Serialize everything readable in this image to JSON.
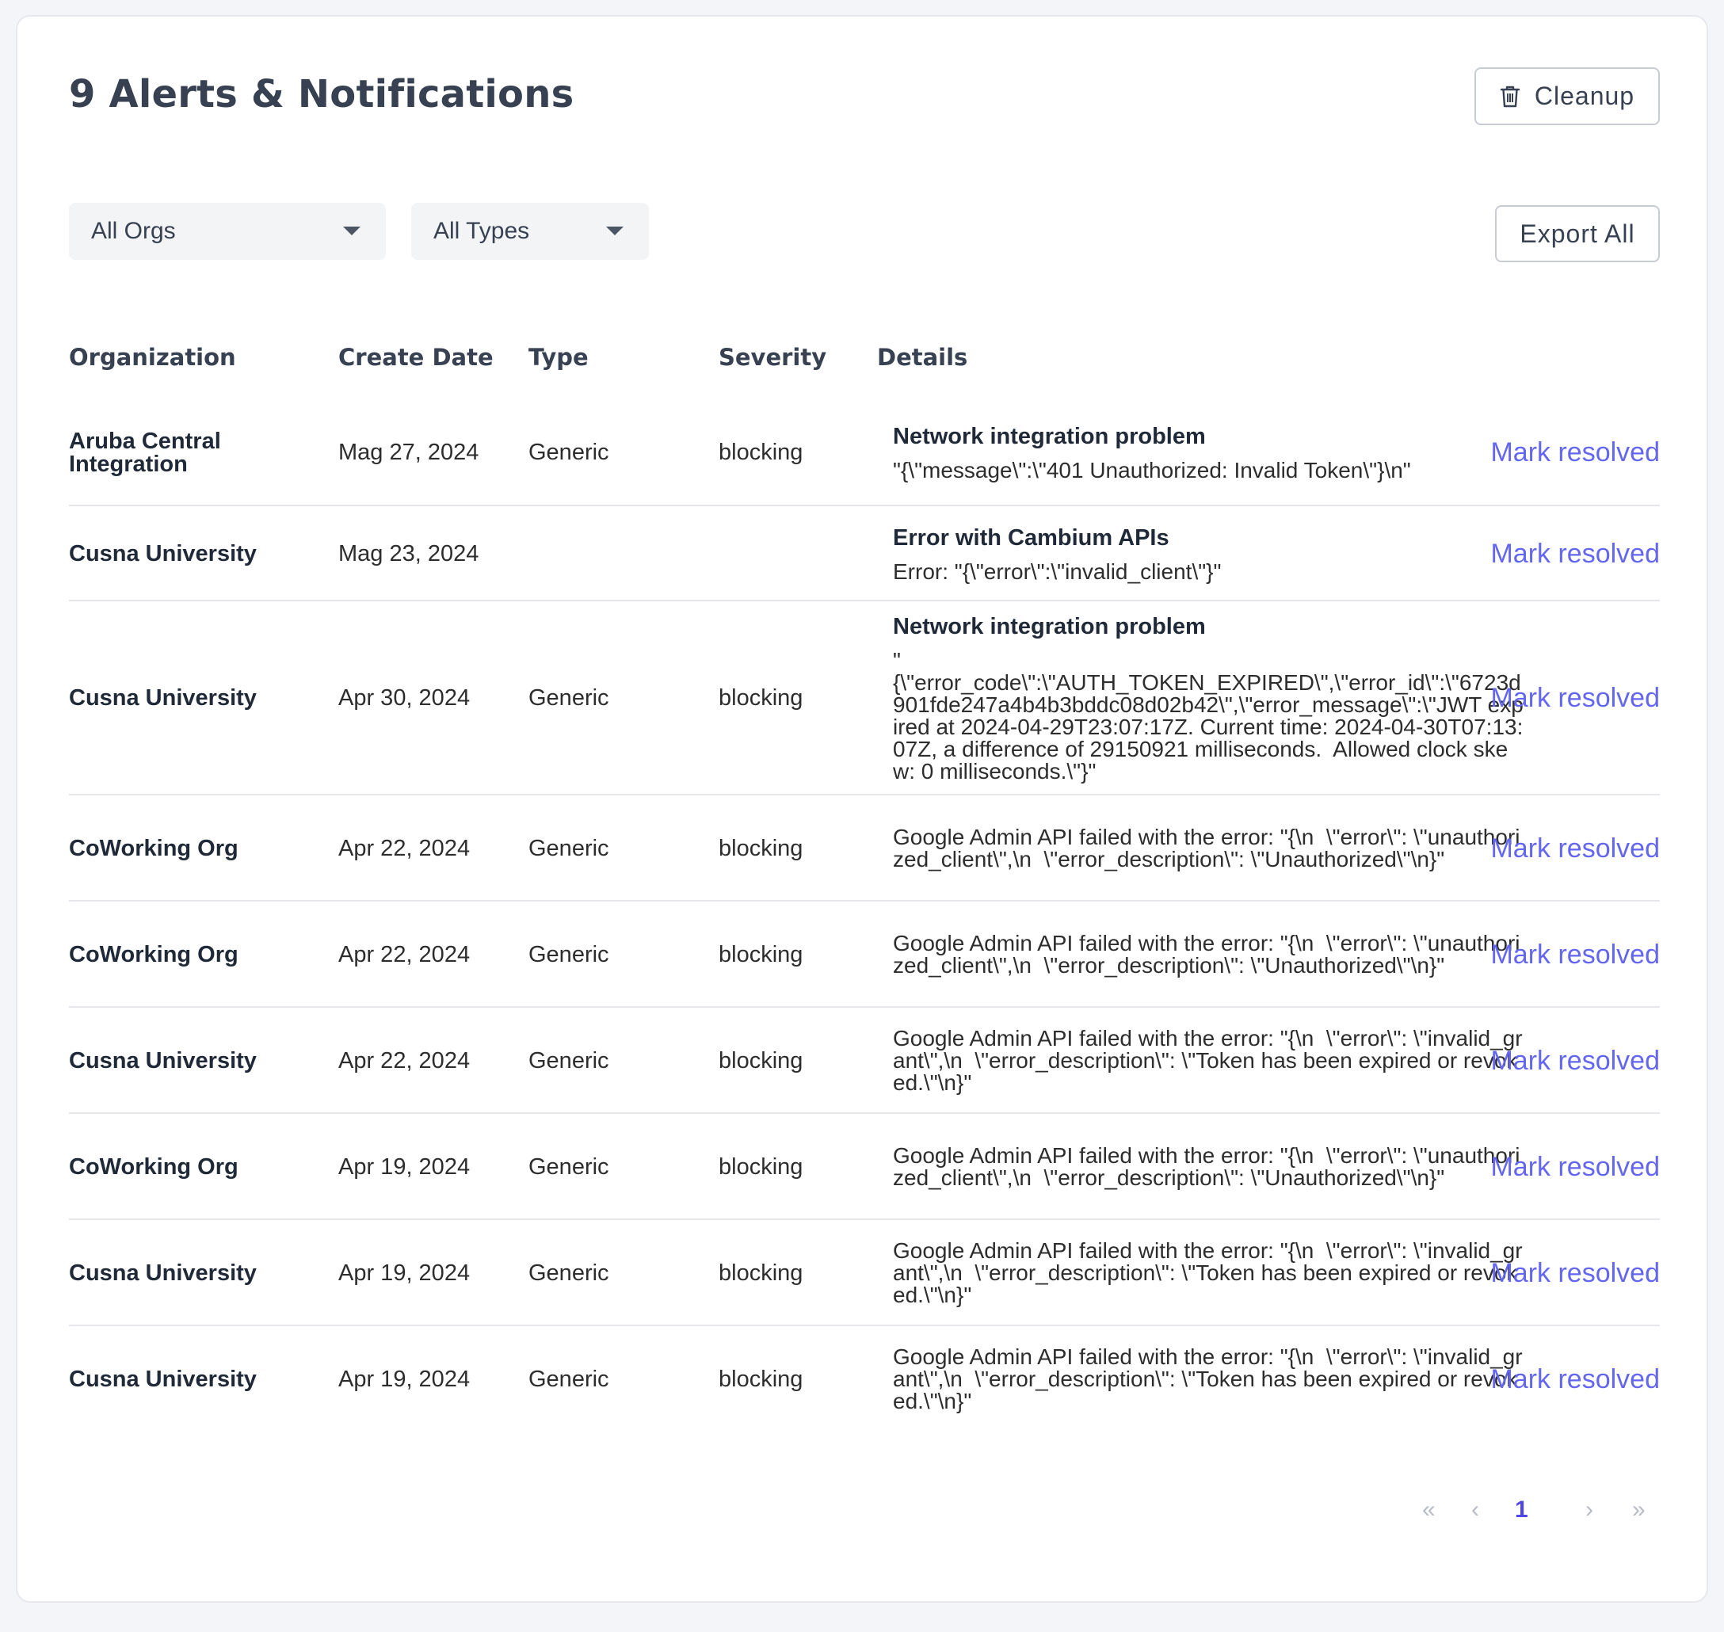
{
  "header": {
    "title": "9 Alerts & Notifications",
    "cleanup_label": "Cleanup",
    "cleanup_icon": "trash-icon",
    "export_label": "Export All"
  },
  "filters": {
    "org_selected": "All Orgs",
    "type_selected": "All Types"
  },
  "table": {
    "columns": [
      "Organization",
      "Create Date",
      "Type",
      "Severity",
      "Details"
    ],
    "action_label": "Mark resolved",
    "rows": [
      {
        "org": "Aruba Central Integration",
        "date": "Mag 27, 2024",
        "type": "Generic",
        "severity": "blocking",
        "detail_title": "Network integration problem",
        "detail_text": "\"{\\\"message\\\":\\\"401 Unauthorized: Invalid Token\\\"}\\n\""
      },
      {
        "org": "Cusna University",
        "date": "Mag 23, 2024",
        "type": "",
        "severity": "",
        "detail_title": "Error with Cambium APIs",
        "detail_text": "Error: \"{\\\"error\\\":\\\"invalid_client\\\"}\""
      },
      {
        "org": "Cusna University",
        "date": "Apr 30, 2024",
        "type": "Generic",
        "severity": "blocking",
        "detail_title": "Network integration problem",
        "detail_text": "\"\n{\\\"error_code\\\":\\\"AUTH_TOKEN_EXPIRED\\\",\\\"error_id\\\":\\\"6723d901fde247a4b4b3bddc08d02b42\\\",\\\"error_message\\\":\\\"JWT expired at 2024-04-29T23:07:17Z. Current time: 2024-04-30T07:13:07Z, a difference of 29150921 milliseconds.  Allowed clock skew: 0 milliseconds.\\\"}\""
      },
      {
        "org": "CoWorking Org",
        "date": "Apr 22, 2024",
        "type": "Generic",
        "severity": "blocking",
        "detail_title": "",
        "detail_text": "Google Admin API failed with the error: \"{\\n  \\\"error\\\": \\\"unauthorized_client\\\",\\n  \\\"error_description\\\": \\\"Unauthorized\\\"\\n}\""
      },
      {
        "org": "CoWorking Org",
        "date": "Apr 22, 2024",
        "type": "Generic",
        "severity": "blocking",
        "detail_title": "",
        "detail_text": "Google Admin API failed with the error: \"{\\n  \\\"error\\\": \\\"unauthorized_client\\\",\\n  \\\"error_description\\\": \\\"Unauthorized\\\"\\n}\""
      },
      {
        "org": "Cusna University",
        "date": "Apr 22, 2024",
        "type": "Generic",
        "severity": "blocking",
        "detail_title": "",
        "detail_text": "Google Admin API failed with the error: \"{\\n  \\\"error\\\": \\\"invalid_grant\\\",\\n  \\\"error_description\\\": \\\"Token has been expired or revoked.\\\"\\n}\""
      },
      {
        "org": "CoWorking Org",
        "date": "Apr 19, 2024",
        "type": "Generic",
        "severity": "blocking",
        "detail_title": "",
        "detail_text": "Google Admin API failed with the error: \"{\\n  \\\"error\\\": \\\"unauthorized_client\\\",\\n  \\\"error_description\\\": \\\"Unauthorized\\\"\\n}\""
      },
      {
        "org": "Cusna University",
        "date": "Apr 19, 2024",
        "type": "Generic",
        "severity": "blocking",
        "detail_title": "",
        "detail_text": "Google Admin API failed with the error: \"{\\n  \\\"error\\\": \\\"invalid_grant\\\",\\n  \\\"error_description\\\": \\\"Token has been expired or revoked.\\\"\\n}\""
      },
      {
        "org": "Cusna University",
        "date": "Apr 19, 2024",
        "type": "Generic",
        "severity": "blocking",
        "detail_title": "",
        "detail_text": "Google Admin API failed with the error: \"{\\n  \\\"error\\\": \\\"invalid_grant\\\",\\n  \\\"error_description\\\": \\\"Token has been expired or revoked.\\\"\\n}\""
      }
    ]
  },
  "pagination": {
    "current_page": "1",
    "first_icon": "double-chevron-left-icon",
    "prev_icon": "chevron-left-icon",
    "next_icon": "chevron-right-icon",
    "last_icon": "double-chevron-right-icon"
  },
  "colors": {
    "accent": "#6366f1",
    "page_bg": "#f4f5f8",
    "card_bg": "#ffffff"
  }
}
